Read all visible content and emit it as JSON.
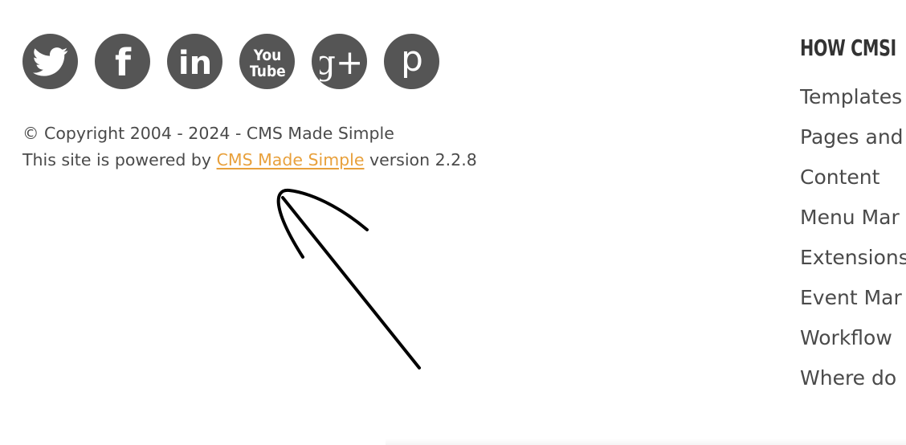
{
  "social_icons": [
    {
      "name": "twitter-icon"
    },
    {
      "name": "facebook-icon"
    },
    {
      "name": "linkedin-icon"
    },
    {
      "name": "youtube-icon"
    },
    {
      "name": "google-plus-icon"
    },
    {
      "name": "pinterest-icon"
    }
  ],
  "youtube": {
    "line1": "You",
    "line2": "Tube"
  },
  "linkedin_text": "in",
  "facebook_text": "f",
  "gplus_text": "g+",
  "pinterest_text": "p",
  "footer": {
    "copyright": "© Copyright 2004 - 2024 - CMS Made Simple",
    "powered_prefix": "This site is powered by ",
    "powered_link": "CMS Made Simple",
    "powered_suffix": " version 2.2.8"
  },
  "sidebar": {
    "heading": "HOW CMSI",
    "items": [
      {
        "label": "Templates"
      },
      {
        "label": "Pages and"
      },
      {
        "label": "Content"
      },
      {
        "label": "Menu Mar"
      },
      {
        "label": "Extensions"
      },
      {
        "label": "Event Mar"
      },
      {
        "label": "Workflow"
      },
      {
        "label": "Where do"
      }
    ]
  },
  "colors": {
    "icon_bg": "#555555",
    "link": "#e8a03b",
    "text": "#4a4a4a"
  }
}
